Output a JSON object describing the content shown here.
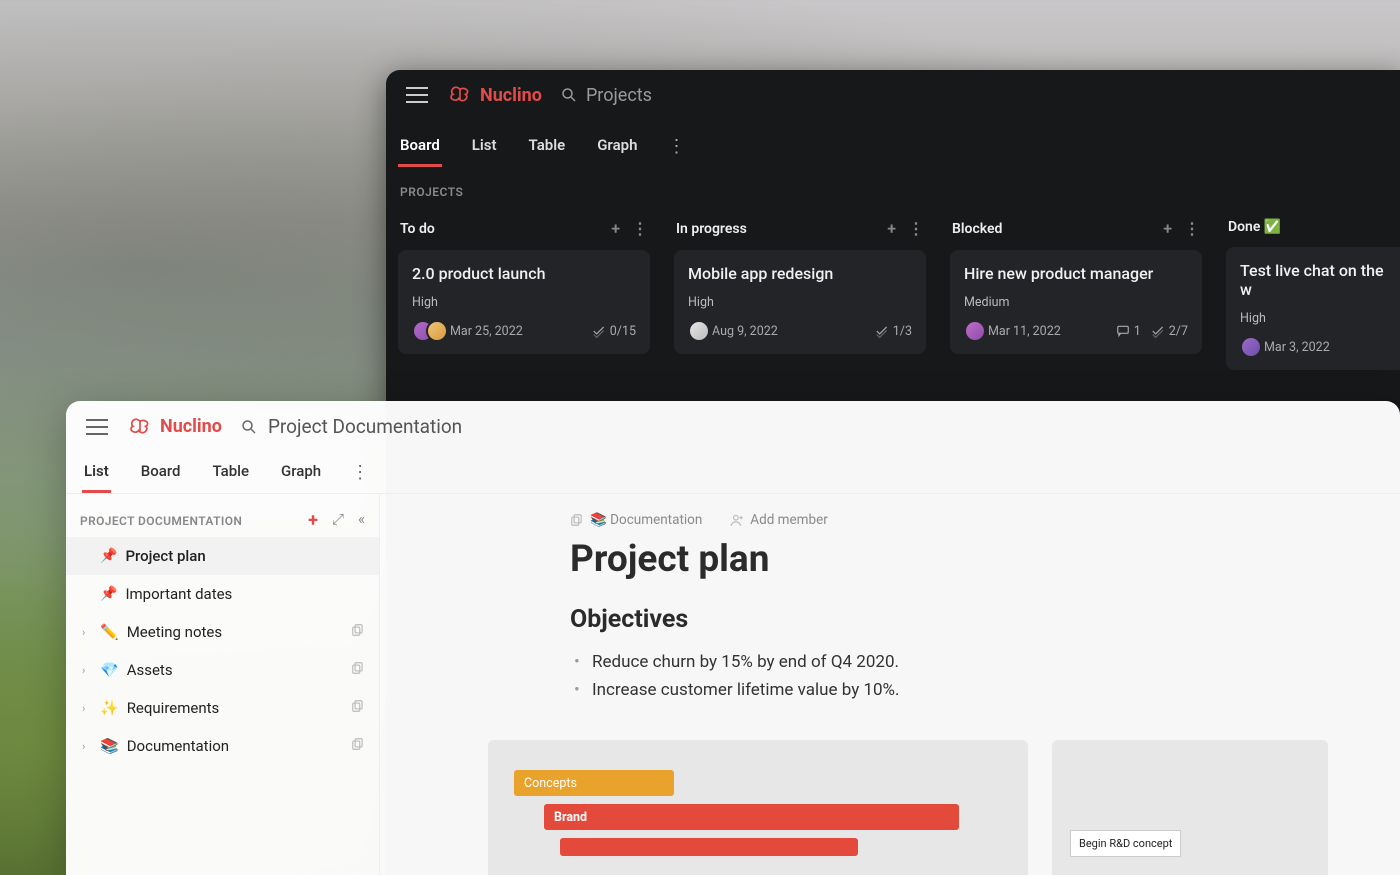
{
  "brand_name": "Nuclino",
  "dark": {
    "search_placeholder": "Projects",
    "tabs": [
      "Board",
      "List",
      "Table",
      "Graph"
    ],
    "section_label": "PROJECTS",
    "columns": [
      {
        "name": "To do"
      },
      {
        "name": "In progress"
      },
      {
        "name": "Blocked"
      },
      {
        "name": "Done ✅"
      }
    ],
    "cards": {
      "todo1": {
        "title": "2.0 product launch",
        "priority": "High",
        "date": "Mar 25, 2022",
        "check": "0/15"
      },
      "inprogress1": {
        "title": "Mobile app redesign",
        "priority": "High",
        "date": "Aug 9, 2022",
        "check": "1/3"
      },
      "blocked1": {
        "title": "Hire new product manager",
        "priority": "Medium",
        "date": "Mar 11, 2022",
        "comments": "1",
        "check": "2/7"
      },
      "done1": {
        "title": "Test live chat on the w",
        "priority": "High",
        "date": "Mar 3, 2022"
      }
    }
  },
  "light": {
    "search_placeholder": "Project Documentation",
    "tabs": [
      "List",
      "Board",
      "Table",
      "Graph"
    ],
    "sidebar": {
      "label": "PROJECT DOCUMENTATION",
      "items": [
        {
          "icon": "📌",
          "label": "Project plan"
        },
        {
          "icon": "📌",
          "label": "Important dates"
        },
        {
          "icon": "✏️",
          "label": "Meeting notes"
        },
        {
          "icon": "💎",
          "label": "Assets"
        },
        {
          "icon": "✨",
          "label": "Requirements"
        },
        {
          "icon": "📚",
          "label": "Documentation"
        }
      ]
    },
    "doc": {
      "crumb_collection": "📚 Documentation",
      "crumb_add_member": "Add member",
      "title": "Project plan",
      "section_heading": "Objectives",
      "bullets": [
        "Reduce churn by 15% by end of Q4 2020.",
        "Increase customer lifetime value by 10%."
      ],
      "gantt": {
        "concepts": "Concepts",
        "brand": "Brand",
        "milestone": "Begin R&D concept"
      }
    }
  }
}
